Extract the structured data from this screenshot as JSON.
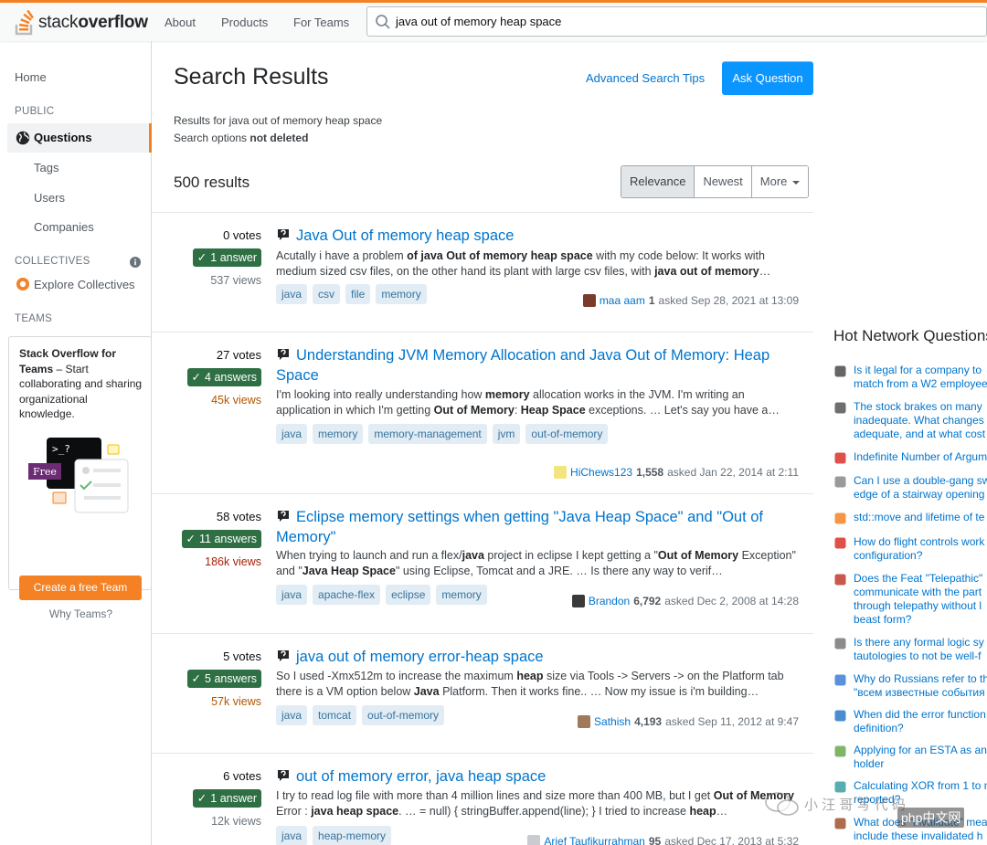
{
  "topbar": {
    "logo_plain": "stack",
    "logo_bold": "overflow",
    "nav": [
      "About",
      "Products",
      "For Teams"
    ],
    "search_value": "java out of memory heap space"
  },
  "left": {
    "home": "Home",
    "public": "PUBLIC",
    "questions": "Questions",
    "tags": "Tags",
    "users": "Users",
    "companies": "Companies",
    "collectives": "COLLECTIVES",
    "explore_collectives": "Explore Collectives",
    "teams": "TEAMS",
    "teams_box": {
      "title": "Stack Overflow for Teams",
      "desc": " – Start collaborating and sharing organizational knowledge.",
      "promo_prompt": ">_?",
      "promo_free": "Free",
      "cta": "Create a free Team",
      "why": "Why Teams?"
    }
  },
  "main": {
    "heading": "Search Results",
    "advanced_tips": "Advanced Search Tips",
    "ask_question": "Ask Question",
    "results_for": "Results for java out of memory heap space",
    "search_options_label": "Search options ",
    "search_options_value": "not deleted",
    "result_count": "500 results",
    "sort": [
      "Relevance",
      "Newest",
      "More"
    ],
    "results": [
      {
        "votes": "0 votes",
        "answers": "1 answer",
        "views": "537 views",
        "title": "Java Out of memory heap space",
        "excerpt_html": "Acutally i have a problem <b>of java Out of memory heap space</b> with my code below: It works with medium sized csv files, on the other hand its plant with large csv files, with <b>java out of memory</b>…",
        "tags": [
          "java",
          "csv",
          "file",
          "memory"
        ],
        "user": "maa aam",
        "rep": "1",
        "asked": "asked Sep 28, 2021 at 13:09"
      },
      {
        "votes": "27 votes",
        "answers": "4 answers",
        "views": "45k views",
        "title": "Understanding JVM Memory Allocation and Java Out of Memory: Heap Space",
        "excerpt_html": "I'm looking into really understanding how <b>memory</b> allocation works in the JVM. I'm writing an application in which I'm getting <b>Out of Memory</b>: <b>Heap Space</b> exceptions. … Let's say you have a…",
        "tags": [
          "java",
          "memory",
          "memory-management",
          "jvm",
          "out-of-memory"
        ],
        "user": "HiChews123",
        "rep": "1,558",
        "asked": "asked Jan 22, 2014 at 2:11"
      },
      {
        "votes": "58 votes",
        "answers": "11 answers",
        "views": "186k views",
        "title": "Eclipse memory settings when getting \"Java Heap Space\" and \"Out of Memory\"",
        "excerpt_html": "When trying to launch and run a flex/<b>java</b> project in eclipse I kept getting a \"<b>Out of Memory</b> Exception\" and \"<b>Java Heap Space</b>\" using Eclipse, Tomcat and a JRE. … Is there any way to verif…",
        "tags": [
          "java",
          "apache-flex",
          "eclipse",
          "memory"
        ],
        "user": "Brandon",
        "rep": "6,792",
        "asked": "asked Dec 2, 2008 at 14:28"
      },
      {
        "votes": "5 votes",
        "answers": "5 answers",
        "views": "57k views",
        "title": "java out of memory error-heap space",
        "excerpt_html": "So I used -Xmx512m to increase the maximum <b>heap</b> size via Tools -> Servers -> on the Platform tab there is a VM option below <b>Java</b> Platform. Then it works fine.. … Now my issue is i'm building…",
        "tags": [
          "java",
          "tomcat",
          "out-of-memory"
        ],
        "user": "Sathish",
        "rep": "4,193",
        "asked": "asked Sep 11, 2012 at 9:47"
      },
      {
        "votes": "6 votes",
        "answers": "1 answer",
        "views": "12k views",
        "title": "out of memory error, java heap space",
        "excerpt_html": "I try to read log file with more than 4 million lines and size more than 400 MB, but I get <b>Out of Memory</b> Error : <b>java heap space</b>. … = null) { stringBuffer.append(line); } I tried to increase <b>heap</b>…",
        "tags": [
          "java",
          "heap-memory"
        ],
        "user": "Arief Taufikurrahman",
        "rep": "95",
        "asked": "asked Dec 17, 2013 at 5:32"
      }
    ]
  },
  "right": {
    "title": "Hot Network Questions",
    "items": [
      {
        "text": "Is it legal for a company to\nmatch from a W2 employee",
        "color": "#4a4a4a"
      },
      {
        "text": "The stock brakes on many\ninadequate. What changes\nadequate, and at what cost",
        "color": "#555"
      },
      {
        "text": "Indefinite Number of Argum",
        "color": "#d9312a"
      },
      {
        "text": "Can I use a double-gang sw\nedge of a stairway opening",
        "color": "#888"
      },
      {
        "text": "std::move and lifetime of te",
        "color": "#f48225"
      },
      {
        "text": "How do flight controls work\nconfiguration?",
        "color": "#d9312a"
      },
      {
        "text": "Does the Feat \"Telepathic\"\ncommunicate with the part\nthrough telepathy without l\nbeast form?",
        "color": "#c0392b"
      },
      {
        "text": "Is there any formal logic sy\ntautologies to not be well-f",
        "color": "#777"
      },
      {
        "text": "Why do Russians refer to th\n\"всем известные события",
        "color": "#3d7ed5"
      },
      {
        "text": "When did the error function\ndefinition?",
        "color": "#2c78c9"
      },
      {
        "text": "Applying for an ESTA as an\nholder",
        "color": "#6aa84f"
      },
      {
        "text": "Calculating XOR from 1 to n\nreported?",
        "color": "#3aa0a0"
      },
      {
        "text": "What does \"invalidate\" mea\ninclude these invalidated h",
        "color": "#a0522d"
      }
    ]
  },
  "watermark": "php中文网"
}
